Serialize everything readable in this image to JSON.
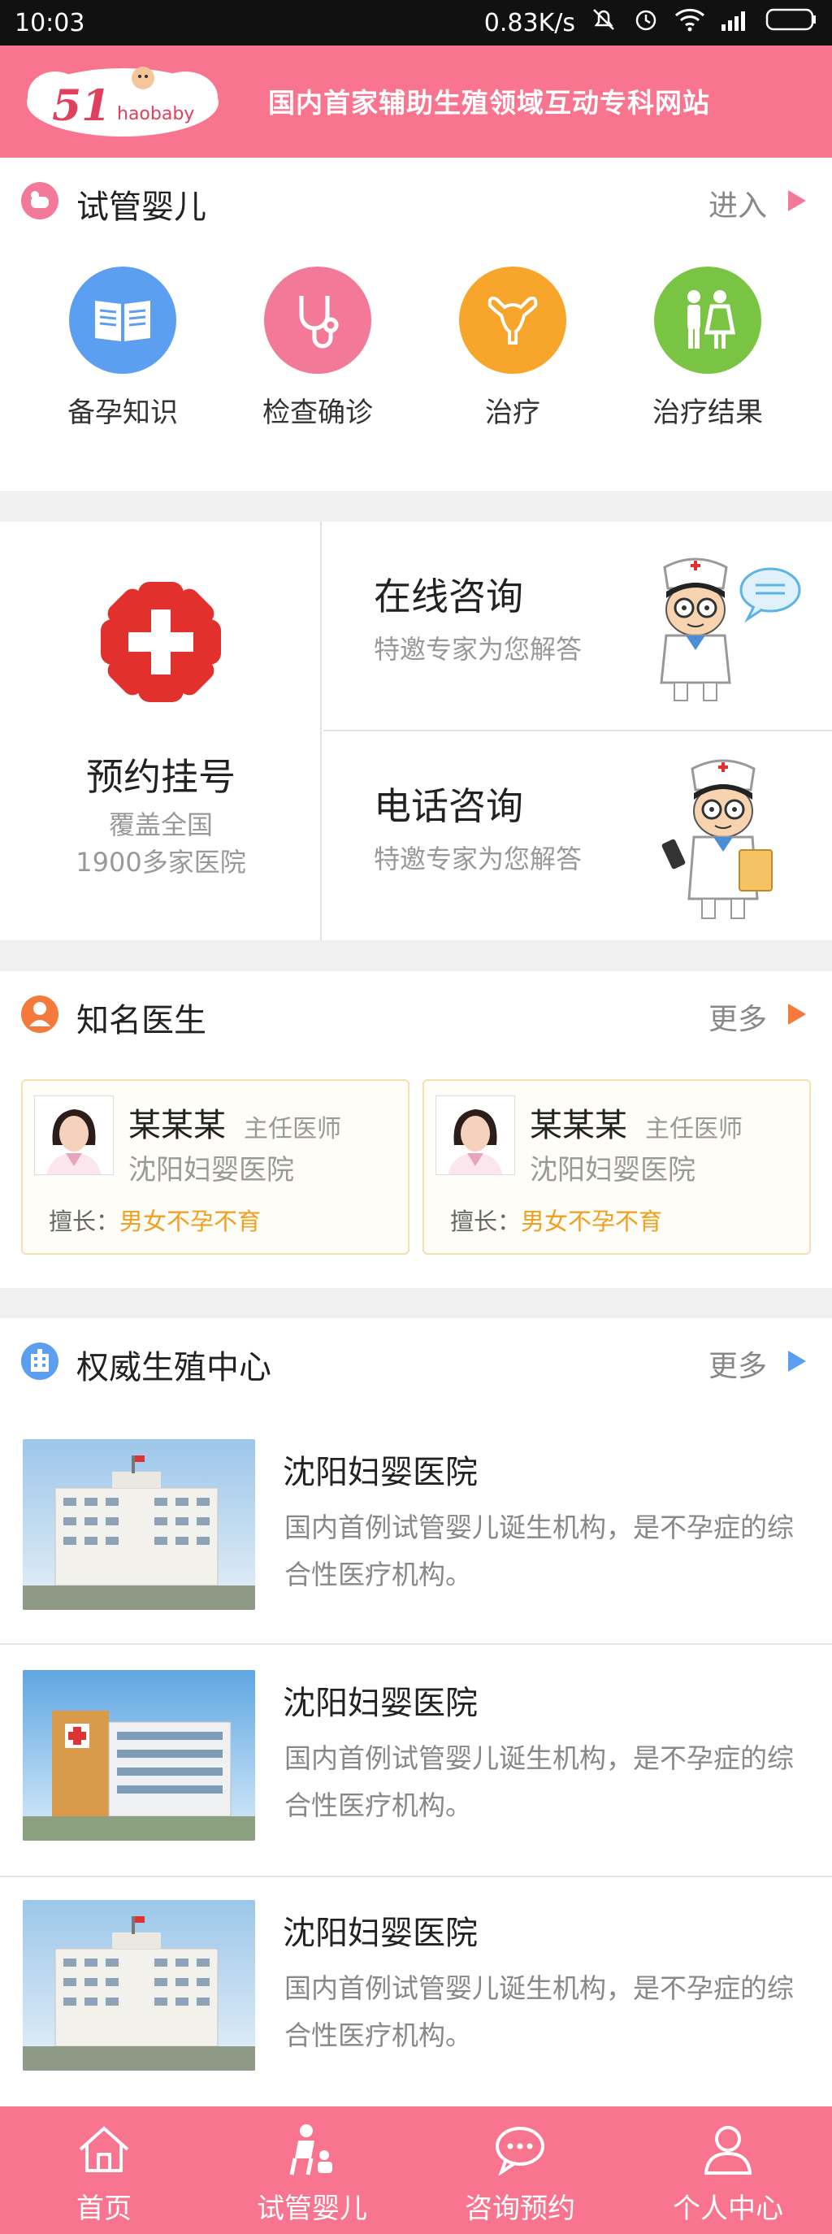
{
  "status_bar": {
    "time": "10:03",
    "network_speed": "0.83K/s"
  },
  "header": {
    "logo_number": "51",
    "logo_text": "haobaby",
    "slogan": "国内首家辅助生殖领域互动专科网站"
  },
  "ivf_section": {
    "title": "试管婴儿",
    "more": "进入",
    "categories": [
      {
        "label": "备孕知识",
        "color": "#5c9ef0",
        "icon": "book-icon"
      },
      {
        "label": "检查确诊",
        "color": "#f27a98",
        "icon": "stethoscope-icon"
      },
      {
        "label": "治疗",
        "color": "#f8a62b",
        "icon": "uterus-icon"
      },
      {
        "label": "治疗结果",
        "color": "#79c543",
        "icon": "family-icon"
      }
    ]
  },
  "consult_section": {
    "registration": {
      "title": "预约挂号",
      "sub_line1": "覆盖全国",
      "sub_line2": "1900多家医院"
    },
    "online": {
      "title": "在线咨询",
      "subtitle": "特邀专家为您解答"
    },
    "phone": {
      "title": "电话咨询",
      "subtitle": "特邀专家为您解答"
    }
  },
  "doctors_section": {
    "title": "知名医生",
    "more": "更多",
    "doctors": [
      {
        "name": "某某某",
        "title": "主任医师",
        "hospital": "沈阳妇婴医院",
        "skill_label": "擅长：",
        "skill": "男女不孕不育"
      },
      {
        "name": "某某某",
        "title": "主任医师",
        "hospital": "沈阳妇婴医院",
        "skill_label": "擅长：",
        "skill": "男女不孕不育"
      }
    ]
  },
  "centers_section": {
    "title": "权威生殖中心",
    "more": "更多",
    "hospitals": [
      {
        "name": "沈阳妇婴医院",
        "desc": "国内首例试管婴儿诞生机构，是不孕症的综合性医疗机构。"
      },
      {
        "name": "沈阳妇婴医院",
        "desc": "国内首例试管婴儿诞生机构，是不孕症的综合性医疗机构。"
      },
      {
        "name": "沈阳妇婴医院",
        "desc": "国内首例试管婴儿诞生机构，是不孕症的综合性医疗机构。"
      }
    ]
  },
  "tab_bar": {
    "tabs": [
      {
        "label": "首页",
        "icon": "home-icon"
      },
      {
        "label": "试管婴儿",
        "icon": "ivf-icon"
      },
      {
        "label": "咨询预约",
        "icon": "chat-icon"
      },
      {
        "label": "个人中心",
        "icon": "user-icon"
      }
    ]
  },
  "colors": {
    "brand_pink": "#f9758f",
    "accent_orange": "#f37a3a",
    "accent_blue": "#5c9ef0"
  }
}
